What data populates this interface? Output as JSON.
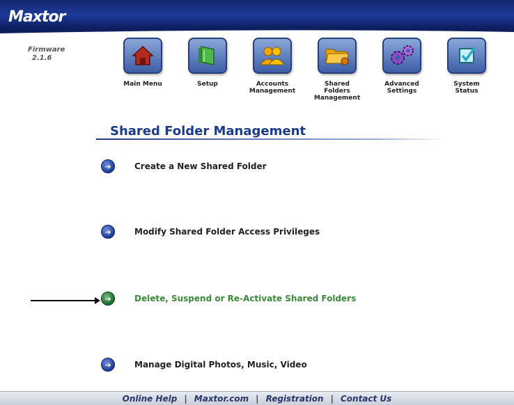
{
  "brand": {
    "logo": "Maxtor"
  },
  "firmware": {
    "label": "Firmware",
    "version": "2.1.6"
  },
  "nav": {
    "main_menu": "Main Menu",
    "setup": "Setup",
    "accounts_1": "Accounts",
    "accounts_2": "Management",
    "shared_1": "Shared",
    "shared_2": "Folders",
    "shared_3": "Management",
    "advanced_1": "Advanced",
    "advanced_2": "Settings",
    "status_1": "System",
    "status_2": "Status"
  },
  "page": {
    "title": "Shared Folder Management"
  },
  "menu": {
    "create": "Create a New Shared Folder",
    "modify": "Modify Shared Folder Access Privileges",
    "delete": "Delete, Suspend or Re-Activate Shared Folders",
    "media": "Manage Digital Photos, Music, Video"
  },
  "footer": {
    "help": "Online Help",
    "site": "Maxtor.com",
    "registration": "Registration",
    "contact": "Contact Us",
    "separator": "|"
  },
  "colors": {
    "header": "#1d3a9a",
    "title": "#1b3a87",
    "active_link": "#3a8a3a"
  }
}
